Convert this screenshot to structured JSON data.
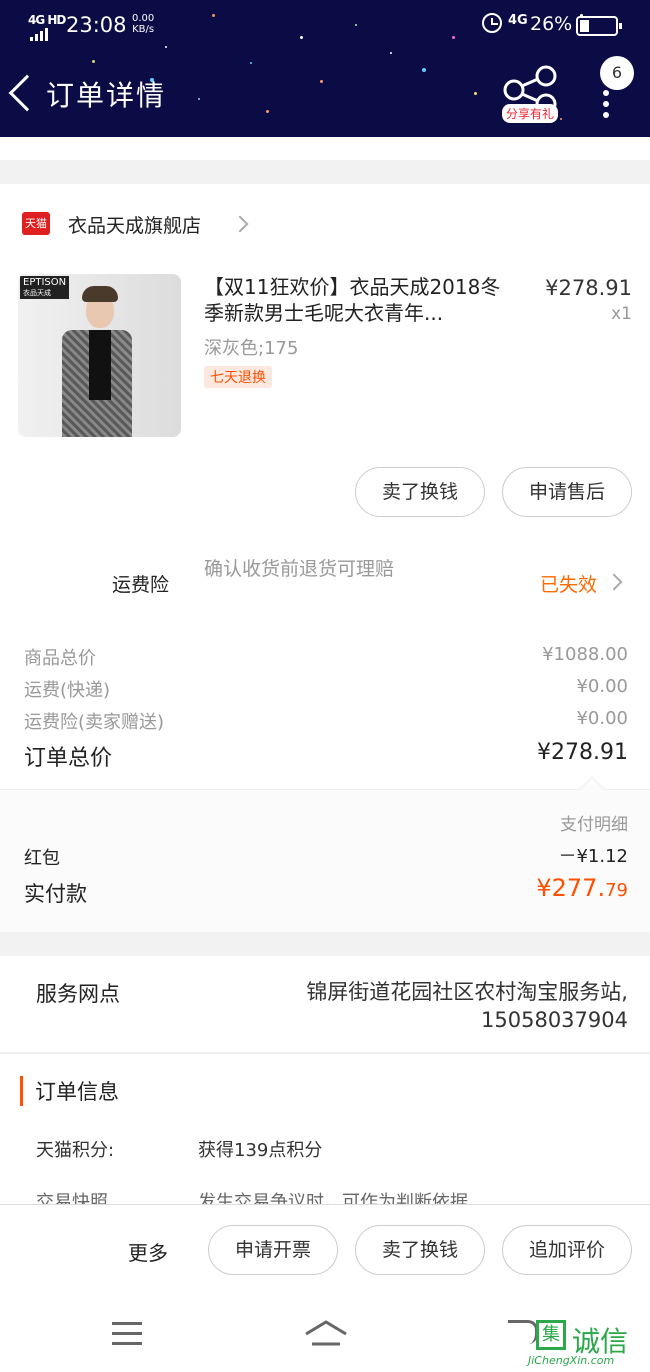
{
  "status_bar": {
    "network": "4G HD",
    "time": "23:08",
    "speed": "0.00",
    "speed_unit": "KB/s",
    "network2": "4G",
    "battery": "26%"
  },
  "header": {
    "title": "订单详情",
    "share_label": "分享有礼",
    "badge_count": "6"
  },
  "store": {
    "logo_text": "天猫",
    "name": "衣品天成旗舰店"
  },
  "product": {
    "image_brand": "EPTISON",
    "image_brand_sub": "衣品天成",
    "title": "【双11狂欢价】衣品天成2018冬季新款男士毛呢大衣青年...",
    "sku": "深灰色;175",
    "tag": "七天退换",
    "price": "¥278.91",
    "qty": "x1"
  },
  "item_actions": {
    "sell_label": "卖了换钱",
    "aftersale_label": "申请售后"
  },
  "insurance": {
    "label": "运费险",
    "desc": "确认收货前退货可理赔",
    "status": "已失效"
  },
  "costs": [
    {
      "label": "商品总价",
      "value": "¥1088.00"
    },
    {
      "label": "运费(快递)",
      "value": "¥0.00"
    },
    {
      "label": "运费险(卖家赠送)",
      "value": "¥0.00"
    }
  ],
  "order_total": {
    "label": "订单总价",
    "value": "¥278.91"
  },
  "payment": {
    "detail_label": "支付明细",
    "redpacket_label": "红包",
    "redpacket_value": "－¥1.12",
    "paid_label": "实付款",
    "paid_main": "¥277.",
    "paid_cents": "79"
  },
  "service": {
    "label": "服务网点",
    "value": "锦屏街道花园社区农村淘宝服务站, 15058037904"
  },
  "order_info": {
    "title": "订单信息",
    "rows": [
      {
        "label": "天猫积分:",
        "value": "获得139点积分"
      },
      {
        "label": "交易快照",
        "value": "发生交易争议时，可作为判断依据"
      }
    ]
  },
  "bottom_actions": {
    "more_label": "更多",
    "invoice_label": "申请开票",
    "sell_label": "卖了换钱",
    "review_label": "追加评价"
  },
  "watermark": {
    "box_char": "集",
    "text": "诚信",
    "url": "JiChengXin.com"
  },
  "colors": {
    "header_bg": "#0b0c45",
    "accent": "#ff5000",
    "expired": "#ff6a00",
    "tmall_red": "#e02020"
  }
}
